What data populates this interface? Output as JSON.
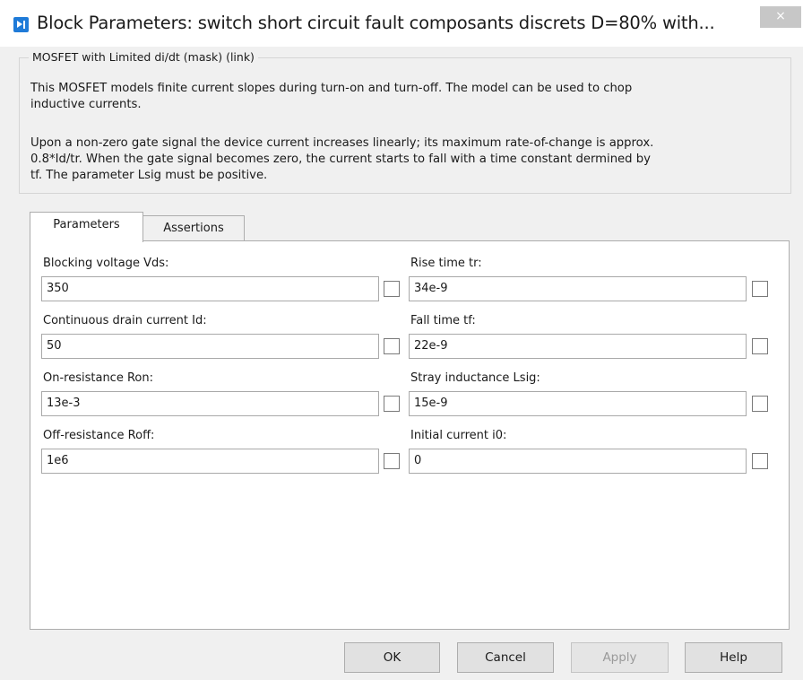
{
  "window": {
    "title": "Block Parameters: switch short circuit fault composants discrets D=80% with...",
    "close_glyph": "×",
    "icon": "simulink-block-icon",
    "close_icon": "close-icon"
  },
  "group": {
    "legend": "MOSFET with Limited di/dt (mask) (link)",
    "description_1": "This MOSFET models finite current slopes during turn-on and turn-off. The model can be used to chop\ninductive currents.",
    "description_2": "Upon a non-zero gate signal the device current increases linearly; its maximum rate-of-change is approx.\n0.8*Id/tr. When the gate signal becomes zero, the current starts to fall with a time constant dermined by\ntf. The parameter Lsig must be positive."
  },
  "tabs": [
    {
      "label": "Parameters",
      "active": true
    },
    {
      "label": "Assertions",
      "active": false
    }
  ],
  "params_left": [
    {
      "label": "Blocking voltage Vds:",
      "value": "350",
      "checked": false
    },
    {
      "label": "Continuous drain current Id:",
      "value": "50",
      "checked": false
    },
    {
      "label": "On-resistance Ron:",
      "value": "13e-3",
      "checked": false
    },
    {
      "label": "Off-resistance Roff:",
      "value": "1e6",
      "checked": false
    }
  ],
  "params_right": [
    {
      "label": "Rise time tr:",
      "value": "34e-9",
      "checked": false
    },
    {
      "label": "Fall time tf:",
      "value": "22e-9",
      "checked": false
    },
    {
      "label": "Stray inductance Lsig:",
      "value": "15e-9",
      "checked": false
    },
    {
      "label": "Initial current i0:",
      "value": "0",
      "checked": false
    }
  ],
  "buttons": {
    "ok": "OK",
    "cancel": "Cancel",
    "apply": "Apply",
    "help": "Help",
    "apply_enabled": false
  }
}
